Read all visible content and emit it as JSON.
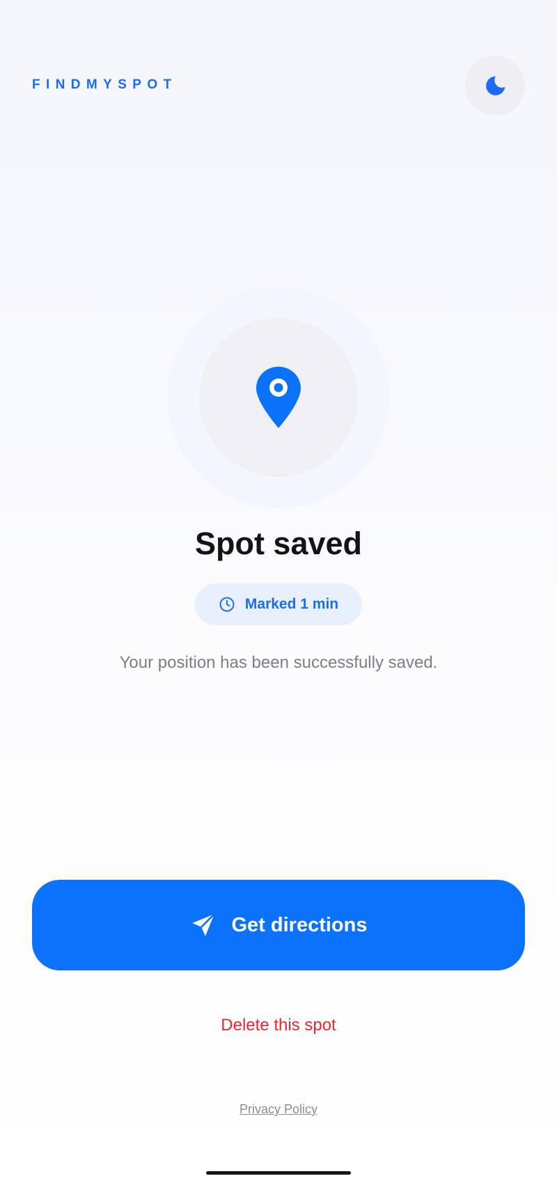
{
  "app": {
    "brand": "FINDMYSPOT"
  },
  "header": {
    "theme_toggle_icon": "moon-icon"
  },
  "status": {
    "icon": "map-pin-icon",
    "title": "Spot saved",
    "badge_icon": "clock-icon",
    "badge_label": "Marked 1 min",
    "message": "Your position has been successfully saved."
  },
  "actions": {
    "directions_icon": "navigation-arrow-icon",
    "directions_label": "Get directions",
    "delete_label": "Delete this spot"
  },
  "footer": {
    "privacy_label": "Privacy Policy"
  },
  "colors": {
    "accent": "#0a72fb",
    "danger": "#f0262c",
    "text": "#141418",
    "muted": "#7d7d85"
  }
}
